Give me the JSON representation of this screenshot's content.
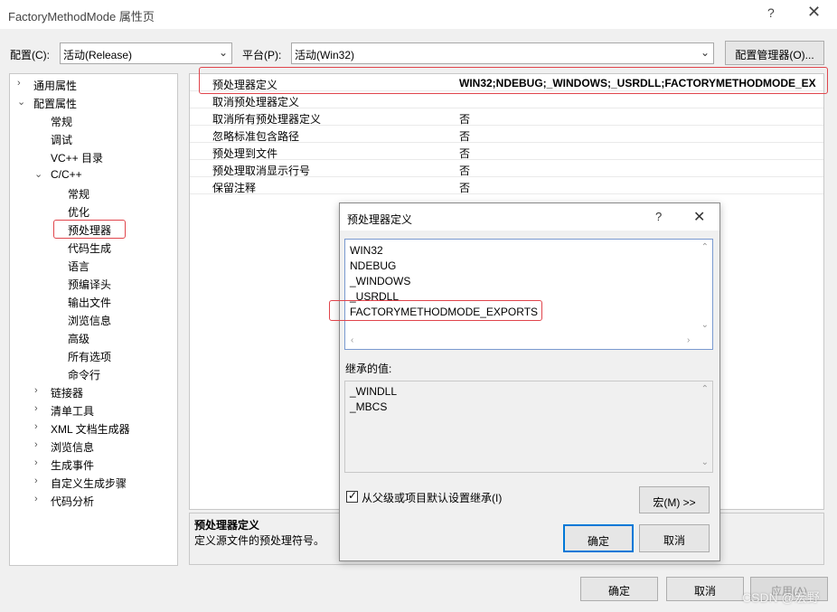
{
  "window": {
    "title": "FactoryMethodMode 属性页",
    "help": "?",
    "close": "✕"
  },
  "config_row": {
    "config_label": "配置(C):",
    "config_value": "活动(Release)",
    "platform_label": "平台(P):",
    "platform_value": "活动(Win32)",
    "manager_button": "配置管理器(O)..."
  },
  "tree": {
    "items": [
      {
        "label": "通用属性",
        "arrow": "›"
      },
      {
        "label": "配置属性",
        "arrow": "⌄"
      },
      {
        "label": "常规"
      },
      {
        "label": "调试"
      },
      {
        "label": "VC++ 目录"
      },
      {
        "label": "C/C++",
        "arrow": "⌄"
      },
      {
        "label": "常规"
      },
      {
        "label": "优化"
      },
      {
        "label": "预处理器"
      },
      {
        "label": "代码生成"
      },
      {
        "label": "语言"
      },
      {
        "label": "预编译头"
      },
      {
        "label": "输出文件"
      },
      {
        "label": "浏览信息"
      },
      {
        "label": "高级"
      },
      {
        "label": "所有选项"
      },
      {
        "label": "命令行"
      },
      {
        "label": "链接器",
        "arrow": "›"
      },
      {
        "label": "清单工具",
        "arrow": "›"
      },
      {
        "label": "XML 文档生成器",
        "arrow": "›"
      },
      {
        "label": "浏览信息",
        "arrow": "›"
      },
      {
        "label": "生成事件",
        "arrow": "›"
      },
      {
        "label": "自定义生成步骤",
        "arrow": "›"
      },
      {
        "label": "代码分析",
        "arrow": "›"
      }
    ]
  },
  "grid": {
    "rows": [
      {
        "key": "预处理器定义",
        "value": "WIN32;NDEBUG;_WINDOWS;_USRDLL;FACTORYMETHODMODE_EX"
      },
      {
        "key": "取消预处理器定义",
        "value": ""
      },
      {
        "key": "取消所有预处理器定义",
        "value": "否"
      },
      {
        "key": "忽略标准包含路径",
        "value": "否"
      },
      {
        "key": "预处理到文件",
        "value": "否"
      },
      {
        "key": "预处理取消显示行号",
        "value": "否"
      },
      {
        "key": "保留注释",
        "value": "否"
      }
    ]
  },
  "description": {
    "title": "预处理器定义",
    "text": "定义源文件的预处理符号。"
  },
  "dialog": {
    "title": "预处理器定义",
    "help": "?",
    "close": "✕",
    "definitions": [
      "WIN32",
      "NDEBUG",
      "_WINDOWS",
      "_USRDLL",
      "FACTORYMETHODMODE_EXPORTS"
    ],
    "inherited_label": "继承的值:",
    "inherited": [
      "_WINDLL",
      "_MBCS"
    ],
    "inherit_checkbox": "从父级或项目默认设置继承(I)",
    "inherit_checked": true,
    "macro_button": "宏(M) >>",
    "ok_button": "确定",
    "cancel_button": "取消"
  },
  "footer": {
    "ok": "确定",
    "cancel": "取消",
    "apply": "应用(A)",
    "watermark": "CSDN @宏野"
  },
  "colors": {
    "highlight_border": "#e0454c",
    "focus_border": "#0078d7"
  }
}
